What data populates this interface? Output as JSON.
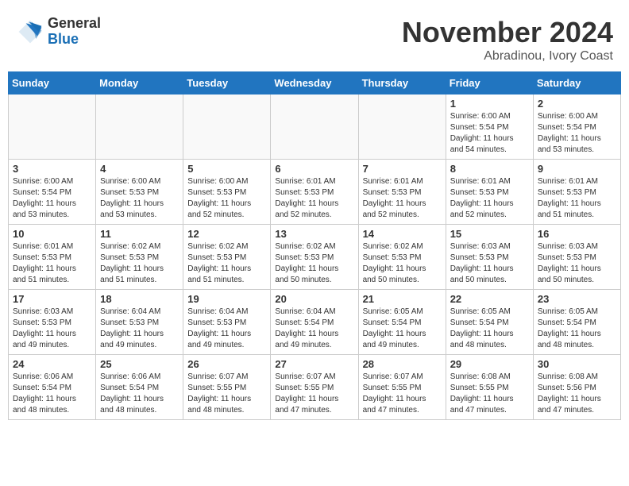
{
  "header": {
    "logo_general": "General",
    "logo_blue": "Blue",
    "month_title": "November 2024",
    "location": "Abradinou, Ivory Coast"
  },
  "weekdays": [
    "Sunday",
    "Monday",
    "Tuesday",
    "Wednesday",
    "Thursday",
    "Friday",
    "Saturday"
  ],
  "weeks": [
    [
      {
        "day": "",
        "info": ""
      },
      {
        "day": "",
        "info": ""
      },
      {
        "day": "",
        "info": ""
      },
      {
        "day": "",
        "info": ""
      },
      {
        "day": "",
        "info": ""
      },
      {
        "day": "1",
        "info": "Sunrise: 6:00 AM\nSunset: 5:54 PM\nDaylight: 11 hours\nand 54 minutes."
      },
      {
        "day": "2",
        "info": "Sunrise: 6:00 AM\nSunset: 5:54 PM\nDaylight: 11 hours\nand 53 minutes."
      }
    ],
    [
      {
        "day": "3",
        "info": "Sunrise: 6:00 AM\nSunset: 5:54 PM\nDaylight: 11 hours\nand 53 minutes."
      },
      {
        "day": "4",
        "info": "Sunrise: 6:00 AM\nSunset: 5:53 PM\nDaylight: 11 hours\nand 53 minutes."
      },
      {
        "day": "5",
        "info": "Sunrise: 6:00 AM\nSunset: 5:53 PM\nDaylight: 11 hours\nand 52 minutes."
      },
      {
        "day": "6",
        "info": "Sunrise: 6:01 AM\nSunset: 5:53 PM\nDaylight: 11 hours\nand 52 minutes."
      },
      {
        "day": "7",
        "info": "Sunrise: 6:01 AM\nSunset: 5:53 PM\nDaylight: 11 hours\nand 52 minutes."
      },
      {
        "day": "8",
        "info": "Sunrise: 6:01 AM\nSunset: 5:53 PM\nDaylight: 11 hours\nand 52 minutes."
      },
      {
        "day": "9",
        "info": "Sunrise: 6:01 AM\nSunset: 5:53 PM\nDaylight: 11 hours\nand 51 minutes."
      }
    ],
    [
      {
        "day": "10",
        "info": "Sunrise: 6:01 AM\nSunset: 5:53 PM\nDaylight: 11 hours\nand 51 minutes."
      },
      {
        "day": "11",
        "info": "Sunrise: 6:02 AM\nSunset: 5:53 PM\nDaylight: 11 hours\nand 51 minutes."
      },
      {
        "day": "12",
        "info": "Sunrise: 6:02 AM\nSunset: 5:53 PM\nDaylight: 11 hours\nand 51 minutes."
      },
      {
        "day": "13",
        "info": "Sunrise: 6:02 AM\nSunset: 5:53 PM\nDaylight: 11 hours\nand 50 minutes."
      },
      {
        "day": "14",
        "info": "Sunrise: 6:02 AM\nSunset: 5:53 PM\nDaylight: 11 hours\nand 50 minutes."
      },
      {
        "day": "15",
        "info": "Sunrise: 6:03 AM\nSunset: 5:53 PM\nDaylight: 11 hours\nand 50 minutes."
      },
      {
        "day": "16",
        "info": "Sunrise: 6:03 AM\nSunset: 5:53 PM\nDaylight: 11 hours\nand 50 minutes."
      }
    ],
    [
      {
        "day": "17",
        "info": "Sunrise: 6:03 AM\nSunset: 5:53 PM\nDaylight: 11 hours\nand 49 minutes."
      },
      {
        "day": "18",
        "info": "Sunrise: 6:04 AM\nSunset: 5:53 PM\nDaylight: 11 hours\nand 49 minutes."
      },
      {
        "day": "19",
        "info": "Sunrise: 6:04 AM\nSunset: 5:53 PM\nDaylight: 11 hours\nand 49 minutes."
      },
      {
        "day": "20",
        "info": "Sunrise: 6:04 AM\nSunset: 5:54 PM\nDaylight: 11 hours\nand 49 minutes."
      },
      {
        "day": "21",
        "info": "Sunrise: 6:05 AM\nSunset: 5:54 PM\nDaylight: 11 hours\nand 49 minutes."
      },
      {
        "day": "22",
        "info": "Sunrise: 6:05 AM\nSunset: 5:54 PM\nDaylight: 11 hours\nand 48 minutes."
      },
      {
        "day": "23",
        "info": "Sunrise: 6:05 AM\nSunset: 5:54 PM\nDaylight: 11 hours\nand 48 minutes."
      }
    ],
    [
      {
        "day": "24",
        "info": "Sunrise: 6:06 AM\nSunset: 5:54 PM\nDaylight: 11 hours\nand 48 minutes."
      },
      {
        "day": "25",
        "info": "Sunrise: 6:06 AM\nSunset: 5:54 PM\nDaylight: 11 hours\nand 48 minutes."
      },
      {
        "day": "26",
        "info": "Sunrise: 6:07 AM\nSunset: 5:55 PM\nDaylight: 11 hours\nand 48 minutes."
      },
      {
        "day": "27",
        "info": "Sunrise: 6:07 AM\nSunset: 5:55 PM\nDaylight: 11 hours\nand 47 minutes."
      },
      {
        "day": "28",
        "info": "Sunrise: 6:07 AM\nSunset: 5:55 PM\nDaylight: 11 hours\nand 47 minutes."
      },
      {
        "day": "29",
        "info": "Sunrise: 6:08 AM\nSunset: 5:55 PM\nDaylight: 11 hours\nand 47 minutes."
      },
      {
        "day": "30",
        "info": "Sunrise: 6:08 AM\nSunset: 5:56 PM\nDaylight: 11 hours\nand 47 minutes."
      }
    ]
  ]
}
